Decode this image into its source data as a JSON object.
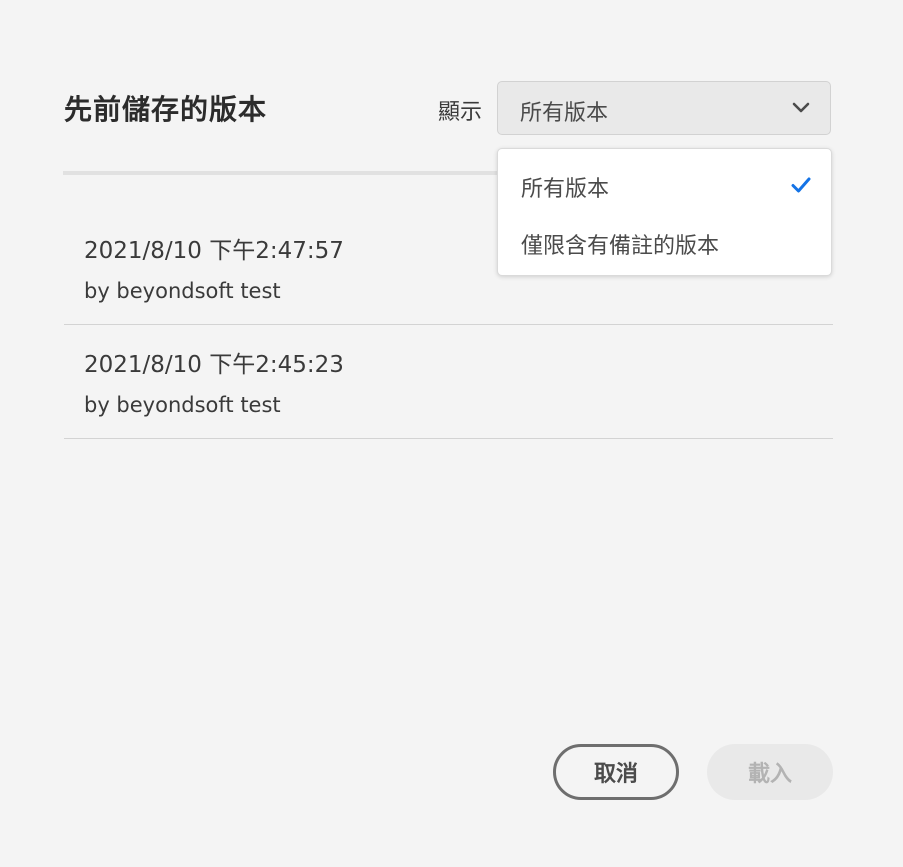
{
  "dialog": {
    "title": "先前儲存的版本",
    "show_label": "顯示",
    "filter": {
      "selected": "所有版本",
      "options": [
        {
          "label": "所有版本",
          "checked": true
        },
        {
          "label": "僅限含有備註的版本",
          "checked": false
        }
      ]
    },
    "versions": [
      {
        "date": "2021/8/10 下午2:47:57",
        "author": "by beyondsoft test"
      },
      {
        "date": "2021/8/10 下午2:45:23",
        "author": "by beyondsoft test"
      }
    ],
    "buttons": {
      "cancel": "取消",
      "load": "載入",
      "load_disabled": true
    }
  },
  "colors": {
    "background": "#f4f4f4",
    "accent_check": "#1473e6",
    "disabled_text": "#b3b3b3"
  }
}
